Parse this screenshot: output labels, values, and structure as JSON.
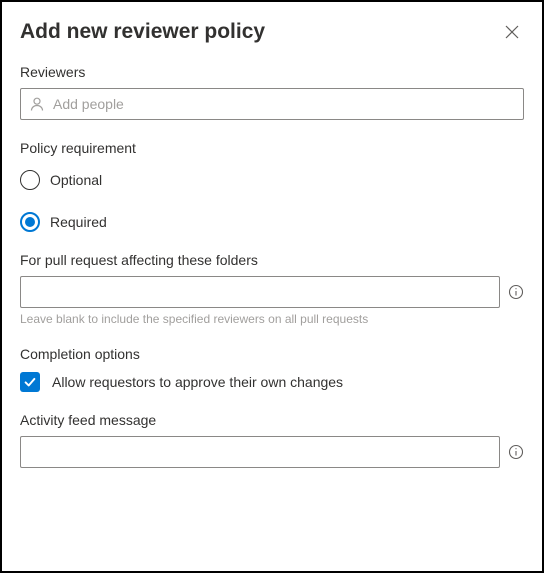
{
  "header": {
    "title": "Add new reviewer policy"
  },
  "reviewers": {
    "label": "Reviewers",
    "placeholder": "Add people"
  },
  "policy_requirement": {
    "label": "Policy requirement",
    "options": [
      {
        "label": "Optional",
        "selected": false
      },
      {
        "label": "Required",
        "selected": true
      }
    ]
  },
  "folders": {
    "label": "For pull request affecting these folders",
    "value": "",
    "helper": "Leave blank to include the specified reviewers on all pull requests"
  },
  "completion": {
    "label": "Completion options",
    "allow_self_approve": {
      "checked": true,
      "label": "Allow requestors to approve their own changes"
    }
  },
  "activity_feed": {
    "label": "Activity feed message",
    "value": ""
  },
  "colors": {
    "accent": "#0078d4"
  }
}
